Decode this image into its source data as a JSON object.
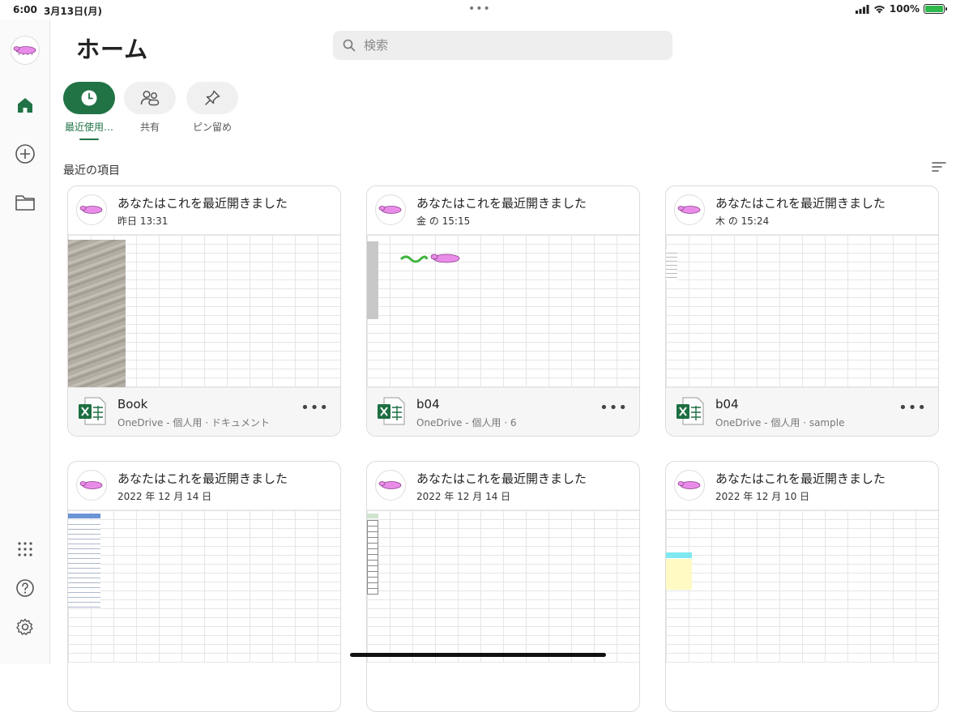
{
  "status": {
    "time": "6:00",
    "date": "3月13日(月)",
    "battery": "100%"
  },
  "sidebar": {
    "items": [
      {
        "name": "home",
        "icon": "home-icon"
      },
      {
        "name": "new",
        "icon": "plus-circle-icon"
      },
      {
        "name": "open",
        "icon": "folder-icon"
      },
      {
        "name": "apps",
        "icon": "grid-icon"
      },
      {
        "name": "help",
        "icon": "help-icon"
      },
      {
        "name": "settings",
        "icon": "gear-icon"
      }
    ]
  },
  "header": {
    "title": "ホーム",
    "search_placeholder": "検索"
  },
  "filters": [
    {
      "label": "最近使用…",
      "icon": "clock-icon",
      "active": true
    },
    {
      "label": "共有",
      "icon": "people-icon",
      "active": false
    },
    {
      "label": "ピン留め",
      "icon": "pin-icon",
      "active": false
    }
  ],
  "section_title": "最近の項目",
  "colors": {
    "accent": "#217346",
    "excel_green": "#1D6F42",
    "avatar_pink": "#E98CE9"
  },
  "cards": [
    {
      "activity": "あなたはこれを最近開きました",
      "time": "昨日 13:31",
      "file": "Book",
      "location": "OneDrive - 個人用 · ドキュメント"
    },
    {
      "activity": "あなたはこれを最近開きました",
      "time": "金 の 15:15",
      "file": "b04",
      "location": "OneDrive - 個人用 · 6"
    },
    {
      "activity": "あなたはこれを最近開きました",
      "time": "木 の 15:24",
      "file": "b04",
      "location": "OneDrive - 個人用 · sample"
    },
    {
      "activity": "あなたはこれを最近開きました",
      "time": "2022 年 12 月 14 日",
      "file": "",
      "location": ""
    },
    {
      "activity": "あなたはこれを最近開きました",
      "time": "2022 年 12 月 14 日",
      "file": "",
      "location": ""
    },
    {
      "activity": "あなたはこれを最近開きました",
      "time": "2022 年 12 月 10 日",
      "file": "",
      "location": ""
    }
  ]
}
